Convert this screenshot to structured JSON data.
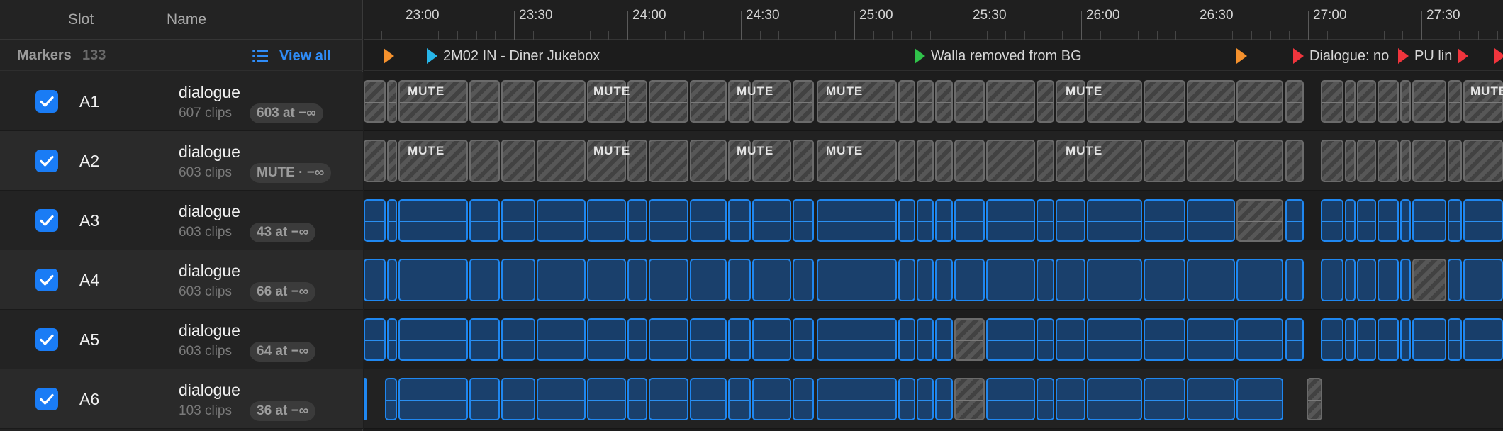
{
  "header": {
    "slot_col": "Slot",
    "name_col": "Name"
  },
  "markers": {
    "label": "Markers",
    "count": "133",
    "view_all": "View all"
  },
  "ruler": [
    "23:00",
    "23:30",
    "24:00",
    "24:30",
    "25:00",
    "25:30",
    "26:00",
    "26:30",
    "27:00",
    "27:30"
  ],
  "marker_items": [
    {
      "label": "",
      "color": "#f5912d"
    },
    {
      "label": "2M02 IN - Diner Jukebox",
      "color": "#27b5e8"
    },
    {
      "label": "Walla removed from BG",
      "color": "#30c24a"
    },
    {
      "label": "",
      "color": "#f5912d"
    },
    {
      "label": "Dialogue: no",
      "color": "#f0353d"
    },
    {
      "label": "PU lin",
      "color": "#f0353d"
    },
    {
      "label": "",
      "color": "#f0353d"
    },
    {
      "label": "",
      "color": "#f0353d"
    }
  ],
  "mute_text": "MUTE",
  "colors": {
    "accent": "#1a7cf5",
    "clip_blue": "#1f87f0",
    "clip_muted": "#4a4a4a"
  },
  "tracks": [
    {
      "slot": "A1",
      "name": "dialogue",
      "clips": "607 clips",
      "badge": "603 at −∞",
      "checked": true
    },
    {
      "slot": "A2",
      "name": "dialogue",
      "clips": "603 clips",
      "badge": "MUTE · −∞",
      "checked": true
    },
    {
      "slot": "A3",
      "name": "dialogue",
      "clips": "603 clips",
      "badge": "43 at −∞",
      "checked": true
    },
    {
      "slot": "A4",
      "name": "dialogue",
      "clips": "603 clips",
      "badge": "66 at −∞",
      "checked": true
    },
    {
      "slot": "A5",
      "name": "dialogue",
      "clips": "603 clips",
      "badge": "64 at −∞",
      "checked": true
    },
    {
      "slot": "A6",
      "name": "dialogue",
      "clips": "103 clips",
      "badge": "36 at −∞",
      "checked": true
    }
  ]
}
